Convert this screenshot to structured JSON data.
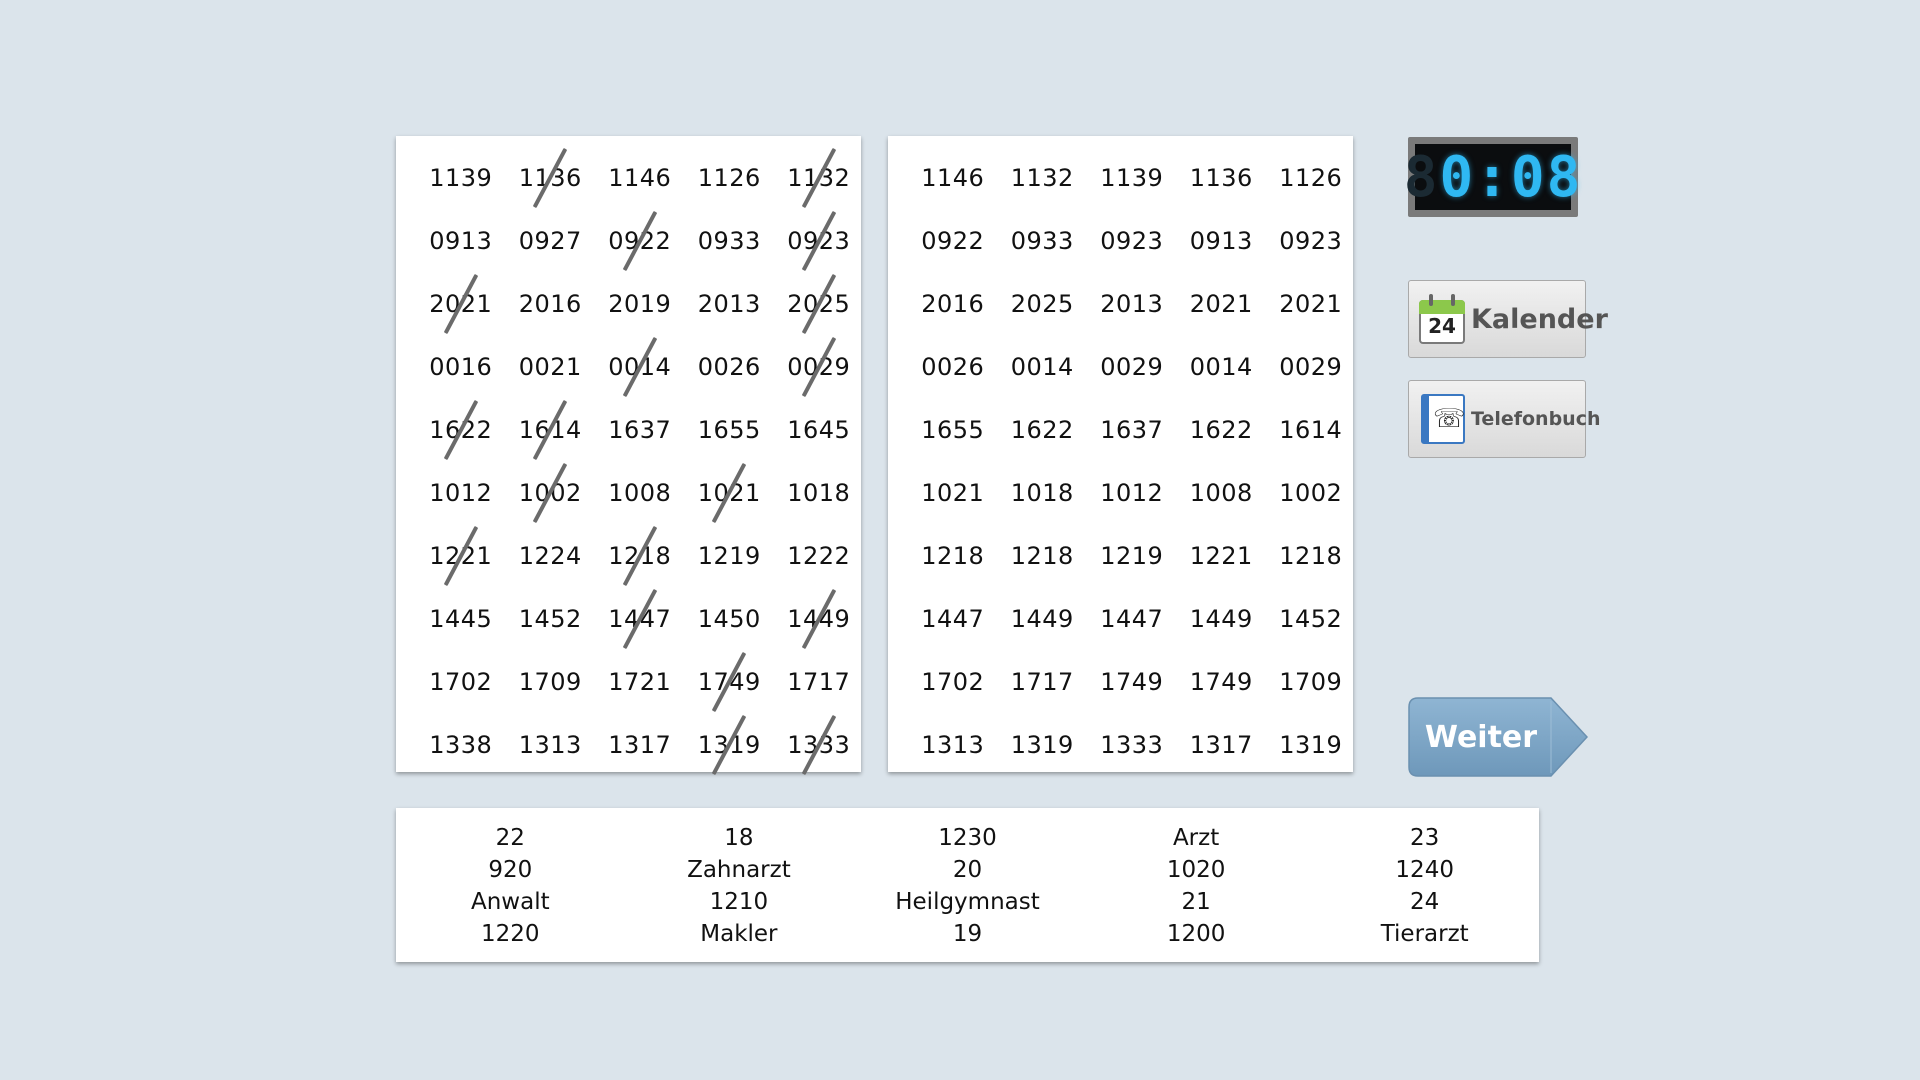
{
  "left_grid": {
    "rows": [
      [
        {
          "v": "1139",
          "x": false
        },
        {
          "v": "1136",
          "x": true
        },
        {
          "v": "1146",
          "x": false
        },
        {
          "v": "1126",
          "x": false
        },
        {
          "v": "1132",
          "x": true
        }
      ],
      [
        {
          "v": "0913",
          "x": false
        },
        {
          "v": "0927",
          "x": false
        },
        {
          "v": "0922",
          "x": true
        },
        {
          "v": "0933",
          "x": false
        },
        {
          "v": "0923",
          "x": true
        }
      ],
      [
        {
          "v": "2021",
          "x": true
        },
        {
          "v": "2016",
          "x": false
        },
        {
          "v": "2019",
          "x": false
        },
        {
          "v": "2013",
          "x": false
        },
        {
          "v": "2025",
          "x": true
        }
      ],
      [
        {
          "v": "0016",
          "x": false
        },
        {
          "v": "0021",
          "x": false
        },
        {
          "v": "0014",
          "x": true
        },
        {
          "v": "0026",
          "x": false
        },
        {
          "v": "0029",
          "x": true
        }
      ],
      [
        {
          "v": "1622",
          "x": true
        },
        {
          "v": "1614",
          "x": true
        },
        {
          "v": "1637",
          "x": false
        },
        {
          "v": "1655",
          "x": false
        },
        {
          "v": "1645",
          "x": false
        }
      ],
      [
        {
          "v": "1012",
          "x": false
        },
        {
          "v": "1002",
          "x": true
        },
        {
          "v": "1008",
          "x": false
        },
        {
          "v": "1021",
          "x": true
        },
        {
          "v": "1018",
          "x": false
        }
      ],
      [
        {
          "v": "1221",
          "x": true
        },
        {
          "v": "1224",
          "x": false
        },
        {
          "v": "1218",
          "x": true
        },
        {
          "v": "1219",
          "x": false
        },
        {
          "v": "1222",
          "x": false
        }
      ],
      [
        {
          "v": "1445",
          "x": false
        },
        {
          "v": "1452",
          "x": false
        },
        {
          "v": "1447",
          "x": true
        },
        {
          "v": "1450",
          "x": false
        },
        {
          "v": "1449",
          "x": true
        }
      ],
      [
        {
          "v": "1702",
          "x": false
        },
        {
          "v": "1709",
          "x": false
        },
        {
          "v": "1721",
          "x": false
        },
        {
          "v": "1749",
          "x": true
        },
        {
          "v": "1717",
          "x": false
        }
      ],
      [
        {
          "v": "1338",
          "x": false
        },
        {
          "v": "1313",
          "x": false
        },
        {
          "v": "1317",
          "x": false
        },
        {
          "v": "1319",
          "x": true
        },
        {
          "v": "1333",
          "x": true
        }
      ]
    ]
  },
  "right_grid": {
    "rows": [
      [
        "1146",
        "1132",
        "1139",
        "1136",
        "1126"
      ],
      [
        "0922",
        "0933",
        "0923",
        "0913",
        "0923"
      ],
      [
        "2016",
        "2025",
        "2013",
        "2021",
        "2021"
      ],
      [
        "0026",
        "0014",
        "0029",
        "0014",
        "0029"
      ],
      [
        "1655",
        "1622",
        "1637",
        "1622",
        "1614"
      ],
      [
        "1021",
        "1018",
        "1012",
        "1008",
        "1002"
      ],
      [
        "1218",
        "1218",
        "1219",
        "1221",
        "1218"
      ],
      [
        "1447",
        "1449",
        "1447",
        "1449",
        "1452"
      ],
      [
        "1702",
        "1717",
        "1749",
        "1749",
        "1709"
      ],
      [
        "1313",
        "1319",
        "1333",
        "1317",
        "1319"
      ]
    ]
  },
  "legend": {
    "columns": [
      [
        "22",
        "920",
        "Anwalt",
        "1220"
      ],
      [
        "18",
        "Zahnarzt",
        "1210",
        "Makler"
      ],
      [
        "1230",
        "20",
        "Heilgymnast",
        "19"
      ],
      [
        "Arzt",
        "1020",
        "21",
        "1200"
      ],
      [
        "23",
        "1240",
        "24",
        "Tierarzt"
      ]
    ]
  },
  "timer": {
    "ghost_digit": "8",
    "value": "0:08"
  },
  "buttons": {
    "kalender_label": "Kalender",
    "kalender_icon_number": "24",
    "kalender_icon": "calendar-icon",
    "telefonbuch_label": "Telefonbuch",
    "telefonbuch_icon": "phonebook-icon",
    "weiter_label": "Weiter"
  },
  "colors": {
    "background": "#dbe4eb",
    "timer_digits": "#2fb8f2",
    "weiter_button": "#7ca6c6",
    "strike": "#6b6b6b"
  }
}
